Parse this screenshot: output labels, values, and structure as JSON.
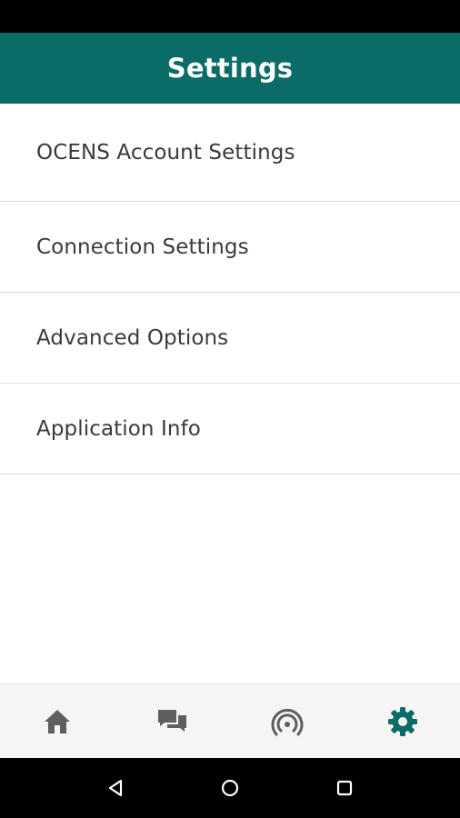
{
  "header": {
    "title": "Settings"
  },
  "settings": {
    "items": [
      {
        "label": "OCENS Account Settings"
      },
      {
        "label": "Connection Settings"
      },
      {
        "label": "Advanced Options"
      },
      {
        "label": "Application Info"
      }
    ]
  },
  "bottom_nav": {
    "tabs": [
      {
        "icon": "home-icon",
        "active": false
      },
      {
        "icon": "chat-icon",
        "active": false
      },
      {
        "icon": "signal-icon",
        "active": false
      },
      {
        "icon": "gear-icon",
        "active": true
      }
    ]
  },
  "colors": {
    "primary": "#0b6b66",
    "nav_icon_inactive": "#5f5f5f",
    "nav_icon_active": "#0b6b66"
  }
}
